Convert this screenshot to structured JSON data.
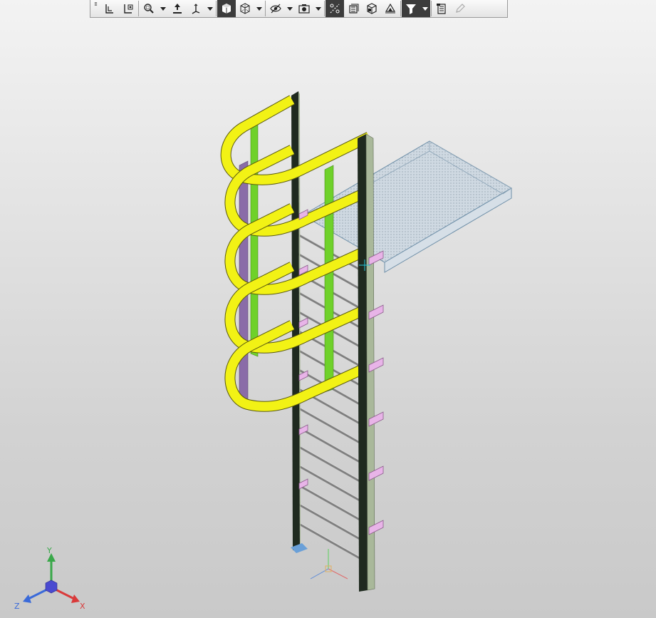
{
  "toolbar": {
    "buttons": [
      {
        "name": "select-icon"
      },
      {
        "name": "local-cs-icon"
      },
      {
        "name": "view-orientation-icon"
      },
      {
        "name": "zoom-window-icon",
        "dropdown": true
      },
      {
        "name": "move-view-icon"
      },
      {
        "name": "rotate-view-icon",
        "dropdown": true
      },
      {
        "name": "shaded-view-icon",
        "active": true
      },
      {
        "name": "wireframe-view-icon",
        "dropdown": true
      },
      {
        "name": "hidden-lines-icon",
        "dropdown": true
      },
      {
        "name": "camera-icon",
        "dropdown": true
      },
      {
        "name": "dimension-view-icon",
        "active": true
      },
      {
        "name": "section-view-icon"
      },
      {
        "name": "layers-view-icon"
      },
      {
        "name": "display-state-icon"
      },
      {
        "name": "filter-icon",
        "active": true,
        "dropdown": true
      },
      {
        "name": "properties-icon"
      },
      {
        "name": "pencil-icon",
        "disabled": true
      }
    ]
  },
  "triad": {
    "x_label": "X",
    "y_label": "Y",
    "z_label": "Z",
    "x_color": "#d93a3a",
    "y_color": "#3aa84a",
    "z_color": "#3a6ad9"
  },
  "colors": {
    "hoop": "#f2f215",
    "green_bar": "#6fd12a",
    "purple_bar": "#8a6ca8",
    "stringer": "#1f2a1f",
    "stringer_side": "#a9b89a",
    "bracket": "#e8b4e8",
    "platform": "#c6d3de",
    "platform_edge": "#6e8fa8"
  }
}
